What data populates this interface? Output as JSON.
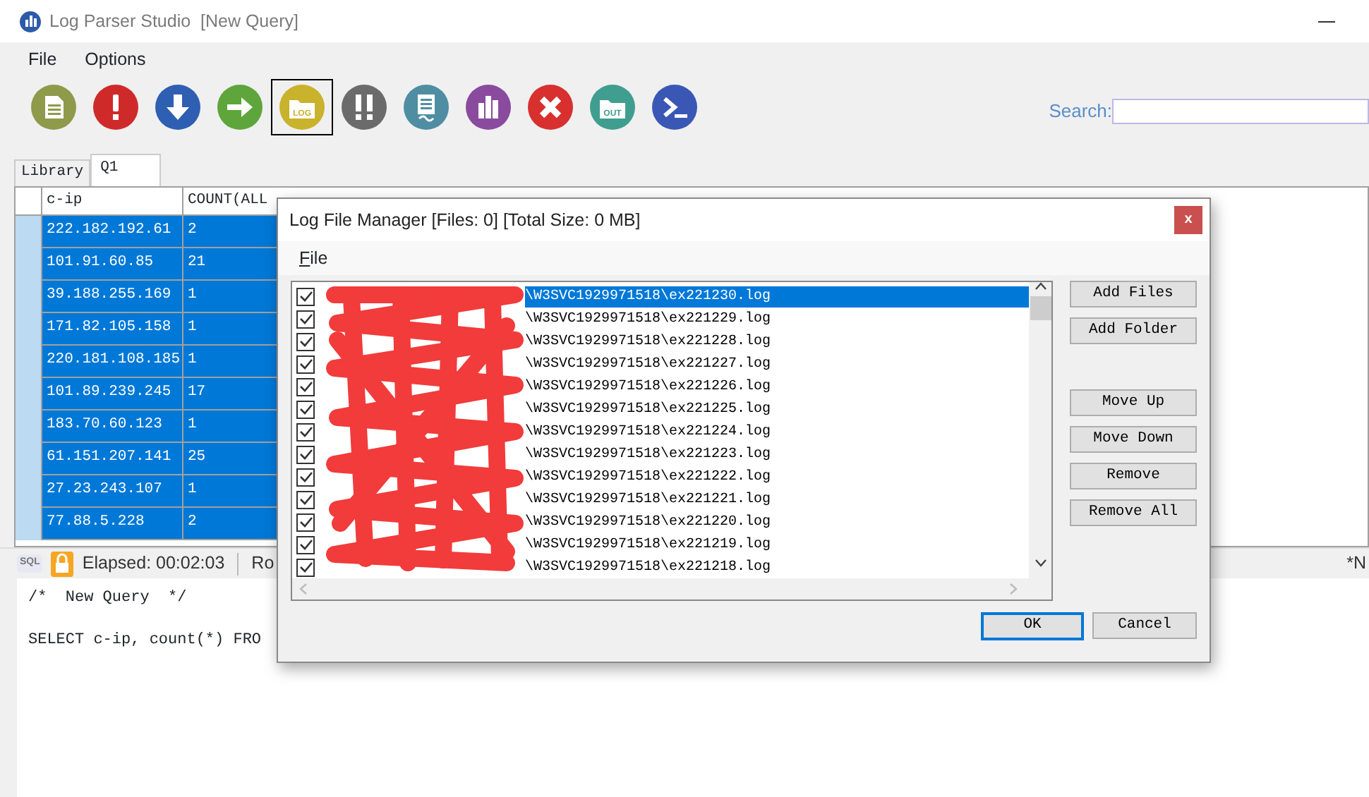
{
  "window": {
    "title": "Log Parser Studio  [New Query]"
  },
  "menu": [
    "File",
    "Options"
  ],
  "toolbar": [
    {
      "kind": "doc",
      "color": "#8f9a4a",
      "selected": false
    },
    {
      "kind": "exclaim",
      "color": "#cf2a2a",
      "selected": false
    },
    {
      "kind": "down",
      "color": "#2f5fb3",
      "selected": false
    },
    {
      "kind": "right",
      "color": "#5ea53c",
      "selected": false
    },
    {
      "kind": "folder",
      "color": "#c9b22c",
      "selected": true,
      "label": "LOG"
    },
    {
      "kind": "double",
      "color": "#6b6b6b",
      "selected": false
    },
    {
      "kind": "page",
      "color": "#4f8ea2",
      "selected": false
    },
    {
      "kind": "chart",
      "color": "#8a4a9e",
      "selected": false
    },
    {
      "kind": "cross",
      "color": "#d7302e",
      "selected": false
    },
    {
      "kind": "folder",
      "color": "#3f9e8f",
      "selected": false,
      "label": "OUT"
    },
    {
      "kind": "prompt",
      "color": "#3a57b5",
      "selected": false
    }
  ],
  "search": {
    "label": "Search:"
  },
  "tabs": [
    {
      "label": "Library",
      "selected": false
    },
    {
      "label": "Q1",
      "selected": true
    }
  ],
  "grid": {
    "columns": [
      "c-ip",
      "COUNT(ALL"
    ],
    "rows": [
      [
        "222.182.192.61",
        "2"
      ],
      [
        "101.91.60.85",
        "21"
      ],
      [
        "39.188.255.169",
        "1"
      ],
      [
        "171.82.105.158",
        "1"
      ],
      [
        "220.181.108.185",
        "1"
      ],
      [
        "101.89.239.245",
        "17"
      ],
      [
        "183.70.60.123",
        "1"
      ],
      [
        "61.151.207.141",
        "25"
      ],
      [
        "27.23.243.107",
        "1"
      ],
      [
        "77.88.5.228",
        "2"
      ]
    ]
  },
  "status_bar": {
    "sql_label": "SQL",
    "elapsed": "Elapsed: 00:02:03",
    "rows": "Ro",
    "right": "*N"
  },
  "editor": {
    "lines": [
      "/*  New Query  */",
      "SELECT c-ip, count(*) FRO"
    ]
  },
  "dialog": {
    "title": "Log File Manager [Files: 0] [Total Size: 0 MB]",
    "close": "x",
    "menu": [
      "File"
    ],
    "files": [
      {
        "path": "\\W3SVC1929971518\\ex221230.log",
        "checked": true,
        "selected": true
      },
      {
        "path": "\\W3SVC1929971518\\ex221229.log",
        "checked": true,
        "selected": false
      },
      {
        "path": "\\W3SVC1929971518\\ex221228.log",
        "checked": true,
        "selected": false
      },
      {
        "path": "\\W3SVC1929971518\\ex221227.log",
        "checked": true,
        "selected": false
      },
      {
        "path": "\\W3SVC1929971518\\ex221226.log",
        "checked": true,
        "selected": false
      },
      {
        "path": "\\W3SVC1929971518\\ex221225.log",
        "checked": true,
        "selected": false
      },
      {
        "path": "\\W3SVC1929971518\\ex221224.log",
        "checked": true,
        "selected": false
      },
      {
        "path": "\\W3SVC1929971518\\ex221223.log",
        "checked": true,
        "selected": false
      },
      {
        "path": "\\W3SVC1929971518\\ex221222.log",
        "checked": true,
        "selected": false
      },
      {
        "path": "\\W3SVC1929971518\\ex221221.log",
        "checked": true,
        "selected": false
      },
      {
        "path": "\\W3SVC1929971518\\ex221220.log",
        "checked": true,
        "selected": false
      },
      {
        "path": "\\W3SVC1929971518\\ex221219.log",
        "checked": true,
        "selected": false
      },
      {
        "path": "\\W3SVC1929971518\\ex221218.log",
        "checked": true,
        "selected": false
      }
    ],
    "side_buttons": [
      [
        "Add Files",
        "Add Folder"
      ],
      [
        "Move Up",
        "Move Down",
        "Remove",
        "Remove All"
      ]
    ],
    "ok": "OK",
    "cancel": "Cancel"
  }
}
